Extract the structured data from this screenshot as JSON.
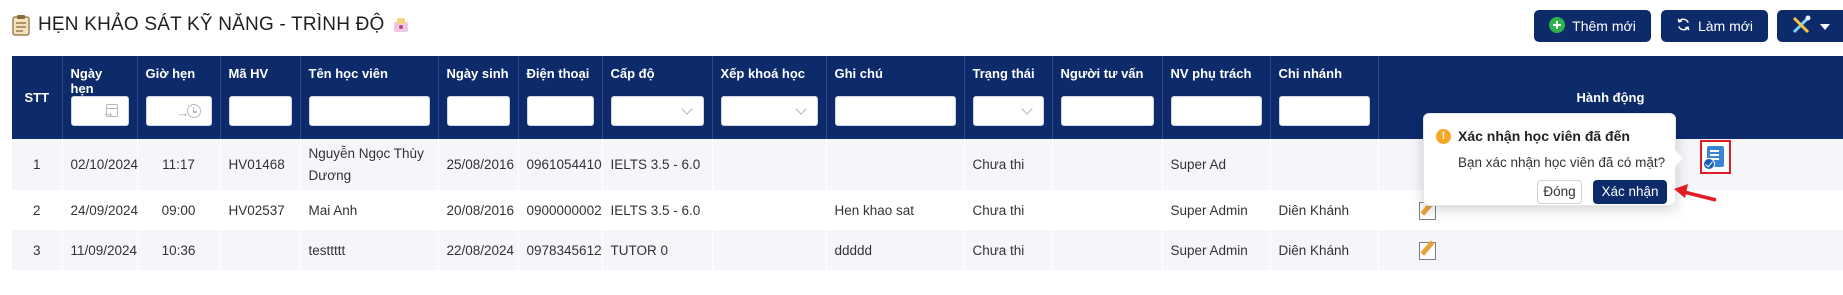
{
  "header": {
    "title": "HẸN KHẢO SÁT KỸ NĂNG - TRÌNH ĐỘ",
    "title_icon": "clipboard-icon",
    "buttons": {
      "add_label": "Thêm mới",
      "refresh_label": "Làm mới"
    }
  },
  "table": {
    "columns": {
      "stt": "STT",
      "date": "Ngày hẹn",
      "time": "Giờ hẹn",
      "code": "Mã HV",
      "name": "Tên học viên",
      "dob": "Ngày sinh",
      "phone": "Điện thoại",
      "level": "Cấp độ",
      "course": "Xếp khoá học",
      "note": "Ghi chú",
      "status": "Trạng thái",
      "advisor": "Người tư vấn",
      "staff": "NV phụ trách",
      "branch": "Chi nhánh",
      "actions": "Hành động"
    },
    "rows": [
      {
        "stt": "1",
        "date": "02/10/2024",
        "time": "11:17",
        "code": "HV01468",
        "name_line1": "Nguyễn Ngọc Thùy",
        "name_line2": "Dương",
        "dob": "25/08/2016",
        "phone": "0961054410",
        "level": "IELTS 3.5 - 6.0",
        "course": "",
        "note": "",
        "status": "Chưa thi",
        "advisor": "",
        "staff": "Super Ad",
        "branch": ""
      },
      {
        "stt": "2",
        "date": "24/09/2024",
        "time": "09:00",
        "code": "HV02537",
        "name": "Mai Anh",
        "dob": "20/08/2016",
        "phone": "0900000002",
        "level": "IELTS 3.5 - 6.0",
        "course": "",
        "note": "Hen khao sat",
        "status": "Chưa thi",
        "advisor": "",
        "staff": "Super Admin",
        "branch": "Diên Khánh"
      },
      {
        "stt": "3",
        "date": "11/09/2024",
        "time": "10:36",
        "code": "",
        "name": "testtttt",
        "dob": "22/08/2024",
        "phone": "0978345612",
        "level": "TUTOR 0",
        "course": "",
        "note": "ddddd",
        "status": "Chưa thi",
        "advisor": "",
        "staff": "Super Admin",
        "branch": "Diên Khánh"
      }
    ]
  },
  "popover": {
    "title": "Xác nhận học viên đã đến",
    "message": "Bạn xác nhận học viên đã có mặt?",
    "cancel_label": "Đóng",
    "confirm_label": "Xác nhận",
    "warning_glyph": "!"
  },
  "colors": {
    "primary": "#0d2a6b",
    "highlight_border": "#e11d24",
    "warning": "#f5a623"
  }
}
